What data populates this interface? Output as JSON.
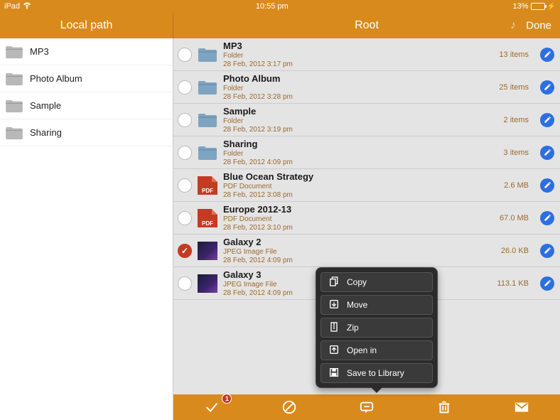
{
  "status": {
    "device": "iPad",
    "time": "10:55 pm",
    "battery_pct": "13%"
  },
  "header": {
    "left_title": "Local path",
    "right_title": "Root",
    "done_label": "Done"
  },
  "sidebar": {
    "items": [
      {
        "label": "MP3"
      },
      {
        "label": "Photo Album"
      },
      {
        "label": "Sample"
      },
      {
        "label": "Sharing"
      }
    ]
  },
  "rows": [
    {
      "name": "MP3",
      "type": "Folder",
      "date": "28 Feb, 2012 3:17 pm",
      "meta": "13 items",
      "kind": "folder",
      "checked": false
    },
    {
      "name": "Photo Album",
      "type": "Folder",
      "date": "28 Feb, 2012 3:28 pm",
      "meta": "25 items",
      "kind": "folder",
      "checked": false
    },
    {
      "name": "Sample",
      "type": "Folder",
      "date": "28 Feb, 2012 3:19 pm",
      "meta": "2 items",
      "kind": "folder",
      "checked": false
    },
    {
      "name": "Sharing",
      "type": "Folder",
      "date": "28 Feb, 2012 4:09 pm",
      "meta": "3 items",
      "kind": "folder",
      "checked": false
    },
    {
      "name": "Blue Ocean Strategy",
      "type": "PDF Document",
      "date": "28 Feb, 2012 3:08 pm",
      "meta": "2.6 MB",
      "kind": "pdf",
      "checked": false
    },
    {
      "name": "Europe 2012-13",
      "type": "PDF Document",
      "date": "28 Feb, 2012 3:10 pm",
      "meta": "67.0 MB",
      "kind": "pdf",
      "checked": false
    },
    {
      "name": "Galaxy 2",
      "type": "JPEG Image File",
      "date": "28 Feb, 2012 4:09 pm",
      "meta": "26.0 KB",
      "kind": "image",
      "checked": true
    },
    {
      "name": "Galaxy 3",
      "type": "JPEG Image File",
      "date": "28 Feb, 2012 4:09 pm",
      "meta": "113.1 KB",
      "kind": "image",
      "checked": false
    }
  ],
  "popover": {
    "items": [
      {
        "label": "Copy",
        "icon": "copy"
      },
      {
        "label": "Move",
        "icon": "move"
      },
      {
        "label": "Zip",
        "icon": "zip"
      },
      {
        "label": "Open in",
        "icon": "openin"
      },
      {
        "label": "Save to Library",
        "icon": "save"
      }
    ]
  },
  "toolbar": {
    "badge_count": "1"
  },
  "pdf_label": "PDF"
}
